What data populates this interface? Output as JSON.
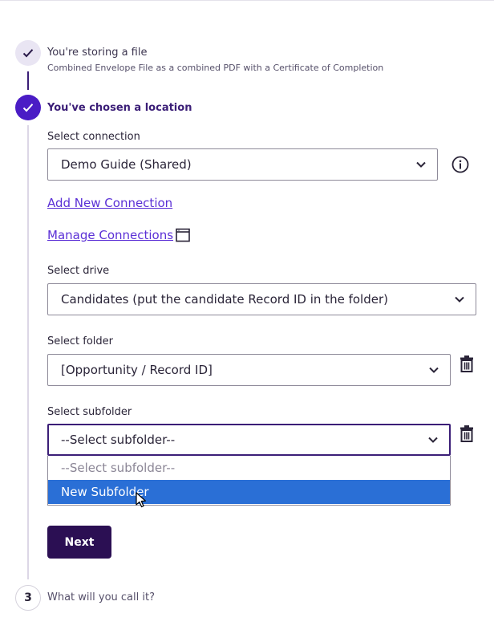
{
  "steps": [
    {
      "title": "You're storing a file",
      "subtitle": "Combined Envelope File as a combined PDF with a Certificate of Completion",
      "status": "complete"
    },
    {
      "title": "You've chosen a location",
      "status": "current"
    },
    {
      "number": "3",
      "title": "What will you call it?",
      "status": "pending"
    }
  ],
  "connection": {
    "label": "Select connection",
    "value": "Demo Guide (Shared)",
    "add_link": "Add New Connection",
    "manage_link": "Manage Connections"
  },
  "drive": {
    "label": "Select drive",
    "value": "Candidates (put the candidate Record ID in the folder)"
  },
  "folder": {
    "label": "Select folder",
    "value": "[Opportunity / Record ID]"
  },
  "subfolder": {
    "label": "Select subfolder",
    "value": "--Select subfolder--",
    "options": [
      "--Select subfolder--",
      "New Subfolder"
    ],
    "highlighted_option": "New Subfolder"
  },
  "next_button": "Next",
  "colors": {
    "accent": "#4a1cc5",
    "dark_button": "#2b0f53",
    "link": "#5b30d6",
    "highlight": "#2a6fd6"
  },
  "icons": [
    "check-icon",
    "info-icon",
    "external-window-icon",
    "trash-icon",
    "chevron-down-icon",
    "mouse-pointer-icon"
  ]
}
